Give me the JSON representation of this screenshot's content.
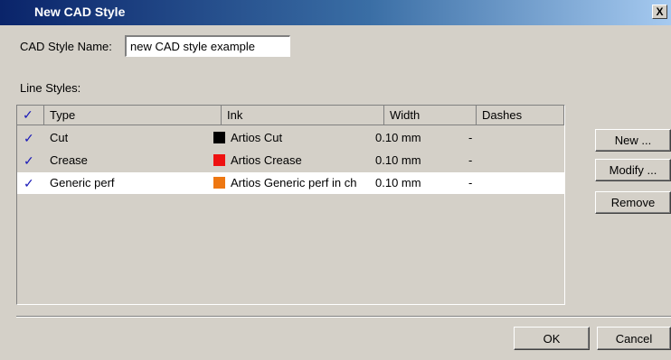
{
  "window": {
    "title": "New CAD Style",
    "close_glyph": "X"
  },
  "name_field": {
    "label": "CAD Style Name:",
    "value": "new CAD style example"
  },
  "line_styles": {
    "label": "Line Styles:",
    "columns": {
      "check": "✓",
      "type": "Type",
      "ink": "Ink",
      "width": "Width",
      "dashes": "Dashes"
    },
    "rows": [
      {
        "checked": "✓",
        "type": "Cut",
        "ink": "Artios Cut",
        "ink_color": "#000000",
        "width": "0.10 mm",
        "dashes": "-"
      },
      {
        "checked": "✓",
        "type": "Crease",
        "ink": "Artios Crease",
        "ink_color": "#ee1111",
        "width": "0.10 mm",
        "dashes": "-"
      },
      {
        "checked": "✓",
        "type": "Generic perf",
        "ink": "Artios Generic perf in ch",
        "ink_color": "#ee7711",
        "width": "0.10 mm",
        "dashes": "-",
        "selected": true
      }
    ]
  },
  "side_buttons": {
    "new": "New ...",
    "modify": "Modify ...",
    "remove": "Remove"
  },
  "footer_buttons": {
    "ok": "OK",
    "cancel": "Cancel"
  }
}
